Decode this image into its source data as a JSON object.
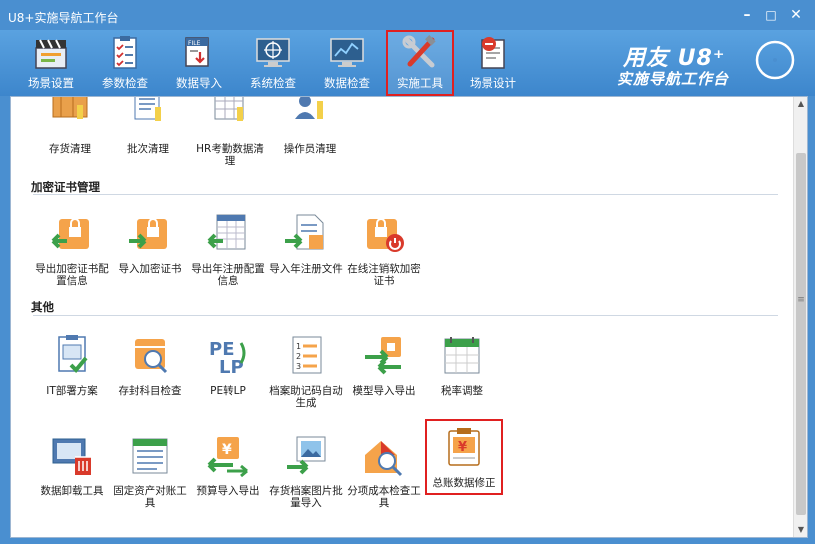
{
  "window": {
    "title": "U8+实施导航工作台",
    "min": "–",
    "max": "□",
    "close": "✕"
  },
  "toolbar": {
    "items": [
      {
        "label": "场景设置",
        "icon": "clapperboard-icon"
      },
      {
        "label": "参数检查",
        "icon": "checklist-icon"
      },
      {
        "label": "数据导入",
        "icon": "file-import-icon"
      },
      {
        "label": "系统检查",
        "icon": "monitor-target-icon"
      },
      {
        "label": "数据检查",
        "icon": "chart-monitor-icon"
      },
      {
        "label": "实施工具",
        "icon": "tools-icon",
        "active": true
      },
      {
        "label": "场景设计",
        "icon": "design-icon"
      }
    ]
  },
  "brand": {
    "line1": "用友 U8⁺",
    "line2": "实施导航工作台"
  },
  "top_items": [
    {
      "label": "存货清理",
      "icon": "inventory-cleanup-icon"
    },
    {
      "label": "批次清理",
      "icon": "batch-cleanup-icon"
    },
    {
      "label": "HR考勤数据清理",
      "icon": "hr-attendance-cleanup-icon"
    },
    {
      "label": "操作员清理",
      "icon": "operator-cleanup-icon"
    }
  ],
  "sections": {
    "cert": "加密证书管理",
    "other": "其他"
  },
  "cert_items": [
    {
      "label": "导出加密证书配置信息",
      "icon": "export-cert-icon"
    },
    {
      "label": "导入加密证书",
      "icon": "import-cert-icon"
    },
    {
      "label": "导出年注册配置信息",
      "icon": "export-registration-icon"
    },
    {
      "label": "导入年注册文件",
      "icon": "import-registration-icon"
    },
    {
      "label": "在线注销软加密证书",
      "icon": "online-revoke-cert-icon"
    }
  ],
  "other_row1": [
    {
      "label": "IT部署方案",
      "icon": "it-deploy-icon"
    },
    {
      "label": "存封科目检查",
      "icon": "account-check-icon"
    },
    {
      "label": "PE转LP",
      "icon": "pe-to-lp-icon"
    },
    {
      "label": "档案助记码自动生成",
      "icon": "mnemonic-generate-icon"
    },
    {
      "label": "模型导入导出",
      "icon": "model-import-export-icon"
    },
    {
      "label": "税率调整",
      "icon": "tax-rate-adjust-icon"
    }
  ],
  "other_row2": [
    {
      "label": "数据卸载工具",
      "icon": "data-unload-icon"
    },
    {
      "label": "固定资产对账工具",
      "icon": "fixed-asset-reconcile-icon"
    },
    {
      "label": "预算导入导出",
      "icon": "budget-import-export-icon"
    },
    {
      "label": "存货档案图片批量导入",
      "icon": "inventory-image-import-icon"
    },
    {
      "label": "分项成本检查工具",
      "icon": "cost-check-icon"
    },
    {
      "label": "总账数据修正",
      "icon": "ledger-fix-icon",
      "highlighted": true
    }
  ]
}
